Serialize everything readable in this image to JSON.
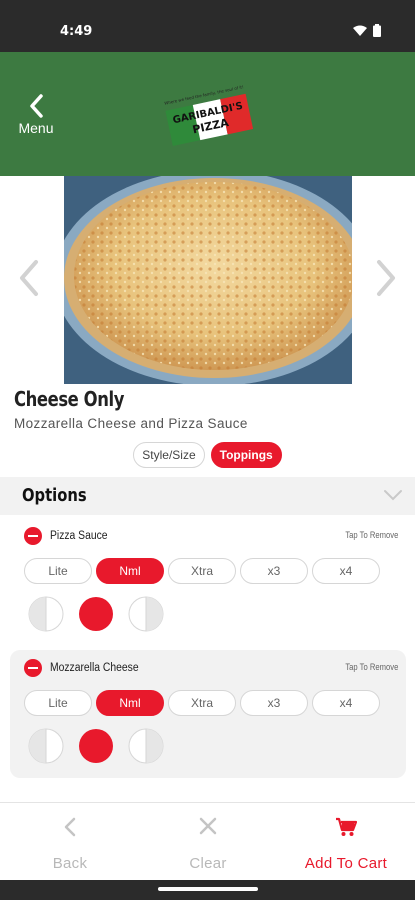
{
  "status_bar": {
    "time": "4:49"
  },
  "header": {
    "menu_label": "Menu",
    "logo_text": "GARIBALDI'S PIZZA",
    "logo_tagline": "Where we feed the family, the soul of it!"
  },
  "item": {
    "title": "Cheese Only",
    "description": "Mozzarella Cheese and Pizza Sauce"
  },
  "tabs": [
    {
      "label": "Style/Size",
      "active": false
    },
    {
      "label": "Toppings",
      "active": true
    }
  ],
  "options": {
    "title": "Options"
  },
  "toppings": [
    {
      "name": "Pizza Sauce",
      "tap_to_remove": "Tap To Remove",
      "amounts": [
        "Lite",
        "Nml",
        "Xtra",
        "x3",
        "x4"
      ],
      "selected_amount": "Nml",
      "selected_coverage": "whole"
    },
    {
      "name": "Mozzarella Cheese",
      "tap_to_remove": "Tap To Remove",
      "amounts": [
        "Lite",
        "Nml",
        "Xtra",
        "x3",
        "x4"
      ],
      "selected_amount": "Nml",
      "selected_coverage": "whole"
    }
  ],
  "bottom_bar": {
    "back_label": "Back",
    "clear_label": "Clear",
    "cart_label": "Add To Cart"
  },
  "colors": {
    "header_green": "#3d7a41",
    "accent_red": "#e8192c"
  }
}
